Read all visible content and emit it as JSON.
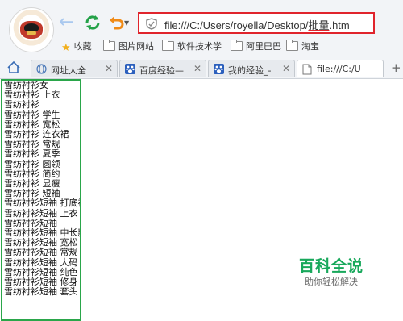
{
  "browser": {
    "url_prefix": "file:///C:/Users/royella/Desktop/",
    "url_highlight": "批量",
    "url_suffix": ".htm"
  },
  "bookmarks": [
    {
      "label": "收藏",
      "icon": "star-icon"
    },
    {
      "label": "图片网站",
      "icon": "folder-icon"
    },
    {
      "label": "软件技术学",
      "icon": "folder-icon"
    },
    {
      "label": "阿里巴巴",
      "icon": "folder-icon"
    },
    {
      "label": "淘宝",
      "icon": "folder-icon"
    }
  ],
  "tabs": [
    {
      "label": "网址大全",
      "icon": "globe-icon"
    },
    {
      "label": "百度经验—",
      "icon": "paw-icon"
    },
    {
      "label": "我的经验_-",
      "icon": "paw-icon"
    },
    {
      "label": "file:///C:/U",
      "icon": "page-icon",
      "active": true
    }
  ],
  "lines": [
    "雪纺衬衫女",
    "雪纺衬衫 上衣",
    "雪纺衬衫",
    "雪纺衬衫 学生",
    "雪纺衬衫 宽松",
    "雪纺衬衫 连衣裙",
    "雪纺衬衫 常规",
    "雪纺衬衫 夏季",
    "雪纺衬衫 圆领",
    "雪纺衬衫 简约",
    "雪纺衬衫 显瘦",
    "雪纺衬衫 短袖",
    "雪纺衬衫短袖 打底衫",
    "雪纺衬衫短袖 上衣",
    "雪纺衬衫短袖",
    "雪纺衬衫短袖 中长款",
    "雪纺衬衫短袖 宽松",
    "雪纺衬衫短袖 常规",
    "雪纺衬衫短袖 大码",
    "雪纺衬衫短袖 纯色",
    "雪纺衬衫短袖 修身",
    "雪纺衬衫短袖 套头"
  ],
  "watermark": {
    "title": "百科全说",
    "subtitle": "助你轻松解决"
  },
  "colors": {
    "highlight_red": "#e0242c",
    "highlight_green": "#2aa64a",
    "brand_green": "#18a85b"
  }
}
